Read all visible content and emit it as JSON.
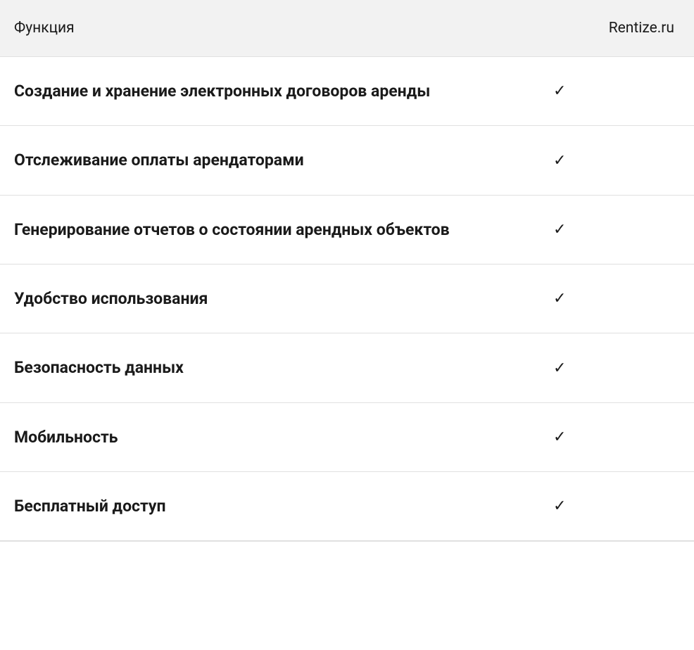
{
  "header": {
    "feature_label": "Функция",
    "brand_label": "Rentize.ru"
  },
  "check_glyph": "✓",
  "rows": [
    {
      "feature": "Создание и хранение электронных договоров аренды",
      "has_check": true
    },
    {
      "feature": "Отслеживание оплаты арендаторами",
      "has_check": true
    },
    {
      "feature": "Генерирование отчетов о состоянии арендных объектов",
      "has_check": true
    },
    {
      "feature": "Удобство использования",
      "has_check": true
    },
    {
      "feature": "Безопасность данных",
      "has_check": true
    },
    {
      "feature": "Мобильность",
      "has_check": true
    },
    {
      "feature": "Бесплатный доступ",
      "has_check": true
    }
  ]
}
